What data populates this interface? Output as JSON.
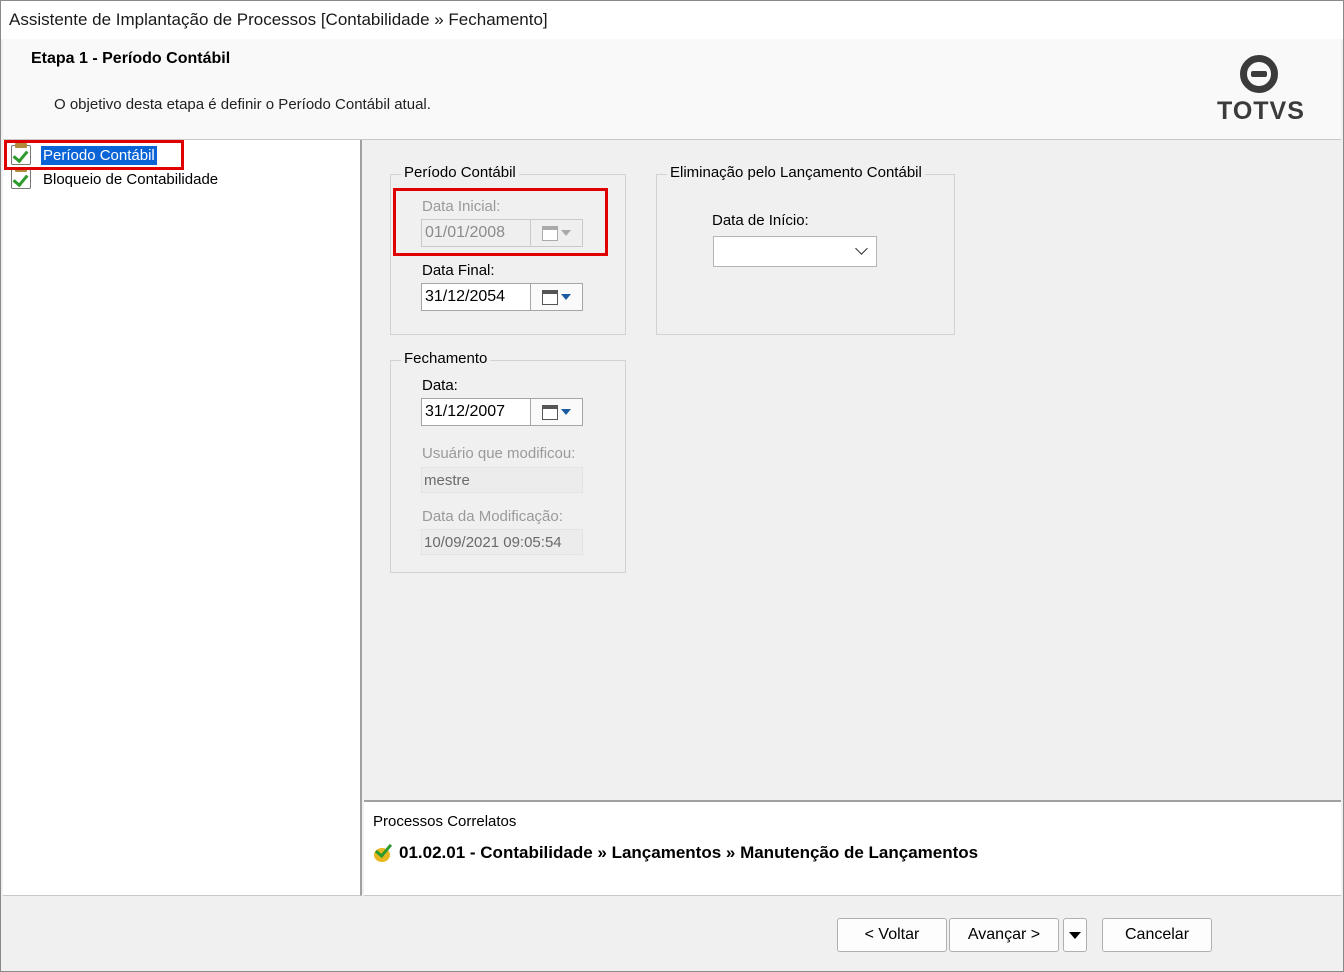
{
  "window": {
    "title": "Assistente de Implantação de Processos [Contabilidade » Fechamento]"
  },
  "header": {
    "step_title": "Etapa 1 - Período Contábil",
    "step_description": "O objetivo desta etapa é definir o Período Contábil atual.",
    "logo_text": "TOTVS"
  },
  "tree": {
    "items": [
      {
        "label": "Período Contábil",
        "selected": true,
        "icon": "checklist-icon"
      },
      {
        "label": "Bloqueio de Contabilidade",
        "selected": false,
        "icon": "checklist-icon"
      }
    ]
  },
  "periodo": {
    "group_title": "Período Contábil",
    "data_inicial_label": "Data Inicial:",
    "data_inicial_value": "01/01/2008",
    "data_final_label": "Data Final:",
    "data_final_value": "31/12/2054"
  },
  "fechamento": {
    "group_title": "Fechamento",
    "data_label": "Data:",
    "data_value": "31/12/2007",
    "usuario_label": "Usuário que modificou:",
    "usuario_value": "mestre",
    "modificacao_label": "Data da Modificação:",
    "modificacao_value": "10/09/2021 09:05:54"
  },
  "eliminacao": {
    "group_title": "Eliminação pelo Lançamento Contábil",
    "data_inicio_label": "Data de Início:",
    "data_inicio_value": ""
  },
  "related": {
    "title": "Processos Correlatos",
    "link": "01.02.01 - Contabilidade » Lançamentos » Manutenção de Lançamentos"
  },
  "footer": {
    "back_label": "< Voltar",
    "next_label": "Avançar >",
    "cancel_label": "Cancelar"
  },
  "colors": {
    "selection": "#0a64d6",
    "highlight_box": "#e00000"
  }
}
